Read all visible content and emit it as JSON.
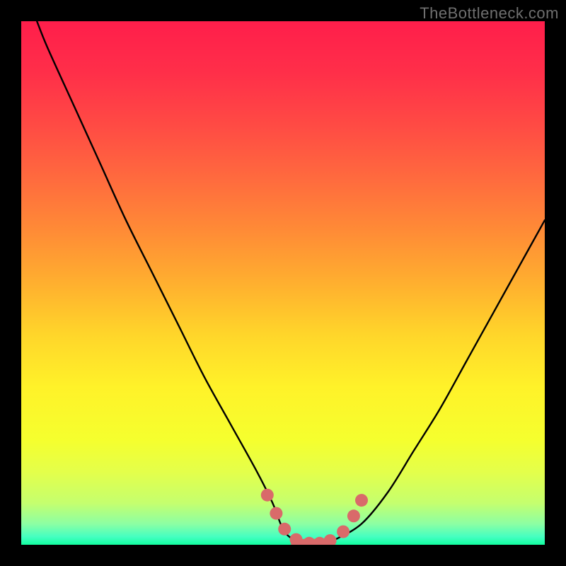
{
  "watermark": "TheBottleneck.com",
  "gradient": {
    "stops": [
      {
        "offset": "0%",
        "color": "#ff1e4b"
      },
      {
        "offset": "10%",
        "color": "#ff2f49"
      },
      {
        "offset": "20%",
        "color": "#ff4b44"
      },
      {
        "offset": "30%",
        "color": "#ff6a3e"
      },
      {
        "offset": "40%",
        "color": "#ff8b36"
      },
      {
        "offset": "50%",
        "color": "#ffaf2f"
      },
      {
        "offset": "60%",
        "color": "#ffd62a"
      },
      {
        "offset": "70%",
        "color": "#fff229"
      },
      {
        "offset": "80%",
        "color": "#f5ff2e"
      },
      {
        "offset": "86%",
        "color": "#e4ff4a"
      },
      {
        "offset": "92%",
        "color": "#c5ff6e"
      },
      {
        "offset": "96%",
        "color": "#8cffa3"
      },
      {
        "offset": "98.5%",
        "color": "#44ffc1"
      },
      {
        "offset": "100%",
        "color": "#12ffa0"
      }
    ]
  },
  "chart_data": {
    "type": "line",
    "title": "",
    "xlabel": "",
    "ylabel": "",
    "xlim": [
      0,
      100
    ],
    "ylim": [
      0,
      100
    ],
    "series": [
      {
        "name": "bottleneck-curve",
        "x": [
          3,
          5,
          10,
          15,
          20,
          25,
          30,
          35,
          40,
          45,
          48,
          50,
          52,
          55,
          58,
          60,
          65,
          70,
          75,
          80,
          85,
          90,
          95,
          100
        ],
        "y": [
          100,
          95,
          84,
          73,
          62,
          52,
          42,
          32,
          23,
          14,
          8,
          3,
          1,
          0,
          0,
          1,
          4,
          10,
          18,
          26,
          35,
          44,
          53,
          62
        ]
      }
    ],
    "markers": {
      "name": "highlight-dots",
      "color": "#d96a6a",
      "points": [
        {
          "x": 47.0,
          "y": 9.5
        },
        {
          "x": 48.7,
          "y": 6.0
        },
        {
          "x": 50.3,
          "y": 3.0
        },
        {
          "x": 52.5,
          "y": 1.0
        },
        {
          "x": 55.0,
          "y": 0.3
        },
        {
          "x": 57.0,
          "y": 0.3
        },
        {
          "x": 59.0,
          "y": 0.8
        },
        {
          "x": 61.5,
          "y": 2.5
        },
        {
          "x": 63.5,
          "y": 5.5
        },
        {
          "x": 65.0,
          "y": 8.5
        }
      ]
    },
    "flat_segment": {
      "name": "valley-bar",
      "color": "#d96a6a",
      "x0": 51.5,
      "x1": 60.0,
      "y": 0.3
    }
  }
}
